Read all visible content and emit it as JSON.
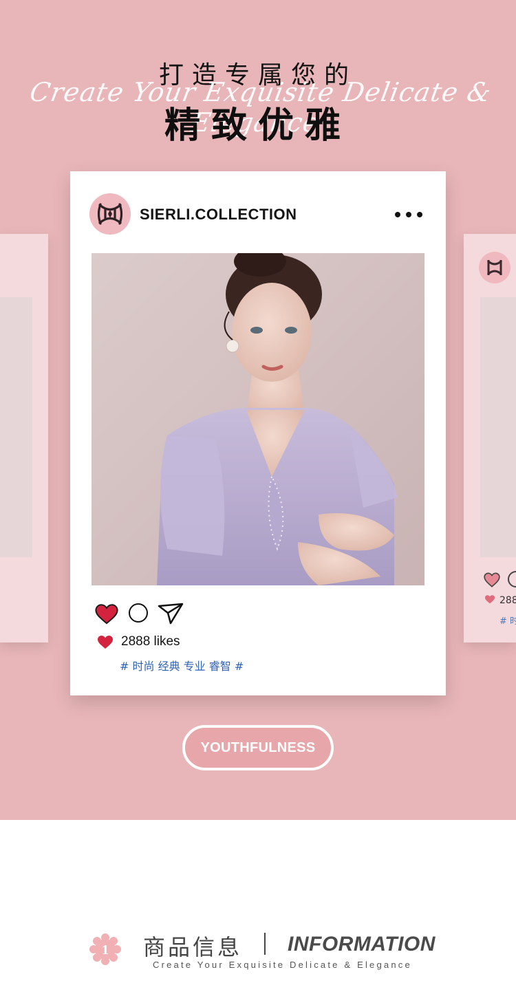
{
  "hero": {
    "headline_top": "打造专属您的",
    "script_line": "Create Your Exquisite Delicate & Elegance",
    "headline_main": "精致优雅",
    "background_color": "#e8b6b8"
  },
  "post": {
    "brand_name": "SIERLI.COLLECTION",
    "likes": "2888 likes",
    "hashtags": "# 时尚 经典 专业 睿智 #",
    "icons": [
      "brand-logo-icon",
      "more-options-icon",
      "heart-icon",
      "comment-icon",
      "share-icon"
    ],
    "heart_color": "#d3233e",
    "hashtag_color": "#2e62b3"
  },
  "side_card_right": {
    "likes_fragment": "288",
    "hashtag_fragment": "# 时"
  },
  "cta": {
    "label": "YOUTHFULNESS"
  },
  "info": {
    "badge_number": "1",
    "title_cn": "商品信息",
    "title_en": "INFORMATION",
    "subtitle": "Create Your Exquisite Delicate & Elegance",
    "badge_color": "#f0b0b4"
  }
}
